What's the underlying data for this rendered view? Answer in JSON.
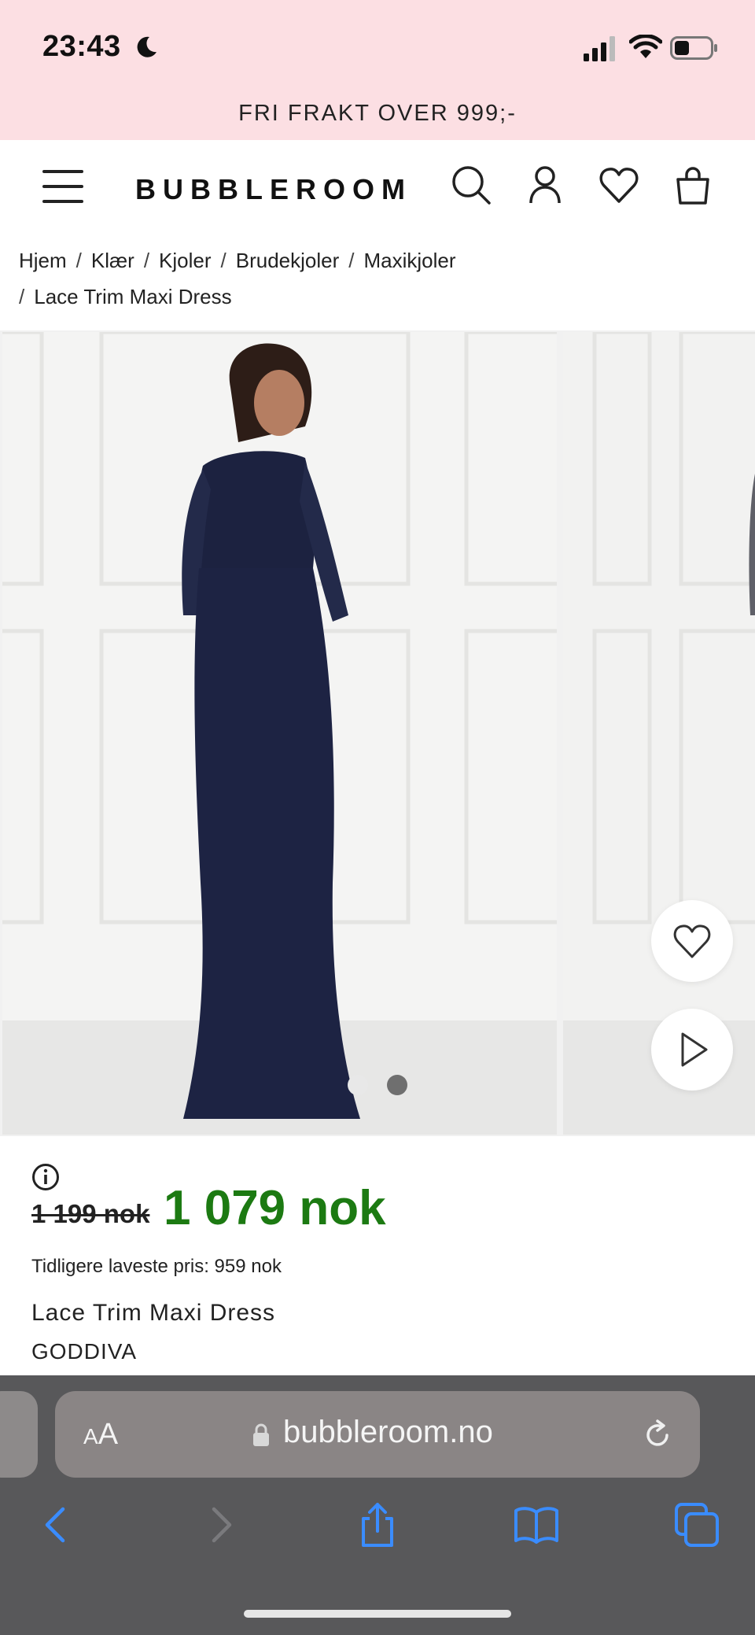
{
  "status_bar": {
    "time": "23:43",
    "icons": [
      "moon-icon",
      "signal-icon",
      "wifi-icon",
      "battery-icon"
    ]
  },
  "promo_banner": "FRI FRAKT OVER 999;-",
  "header": {
    "logo": "BUBBLEROOM",
    "icons": [
      "menu-icon",
      "search-icon",
      "account-icon",
      "wishlist-heart-icon",
      "shopping-bag-icon"
    ]
  },
  "breadcrumb": [
    "Hjem",
    "Klær",
    "Kjoler",
    "Brudekjoler",
    "Maxikjoler",
    "Lace Trim Maxi Dress"
  ],
  "gallery": {
    "image_count": 2,
    "active_index": 1,
    "icons": [
      "favorite-heart-icon",
      "play-video-icon"
    ]
  },
  "product": {
    "old_price": "1 199 nok",
    "new_price": "1 079 nok",
    "lowest_price_text": "Tidligere laveste pris: 959 nok",
    "name": "Lace Trim Maxi Dress",
    "brand": "GODDIVA"
  },
  "browser": {
    "text_size_label": "AA",
    "url": "bubbleroom.no",
    "toolbar_icons": [
      "back-icon",
      "forward-icon",
      "share-icon",
      "bookmarks-icon",
      "tabs-icon"
    ]
  },
  "colors": {
    "banner_bg": "#fcdfe3",
    "sale_price": "#1c7a12",
    "browser_bar": "#58585a"
  }
}
